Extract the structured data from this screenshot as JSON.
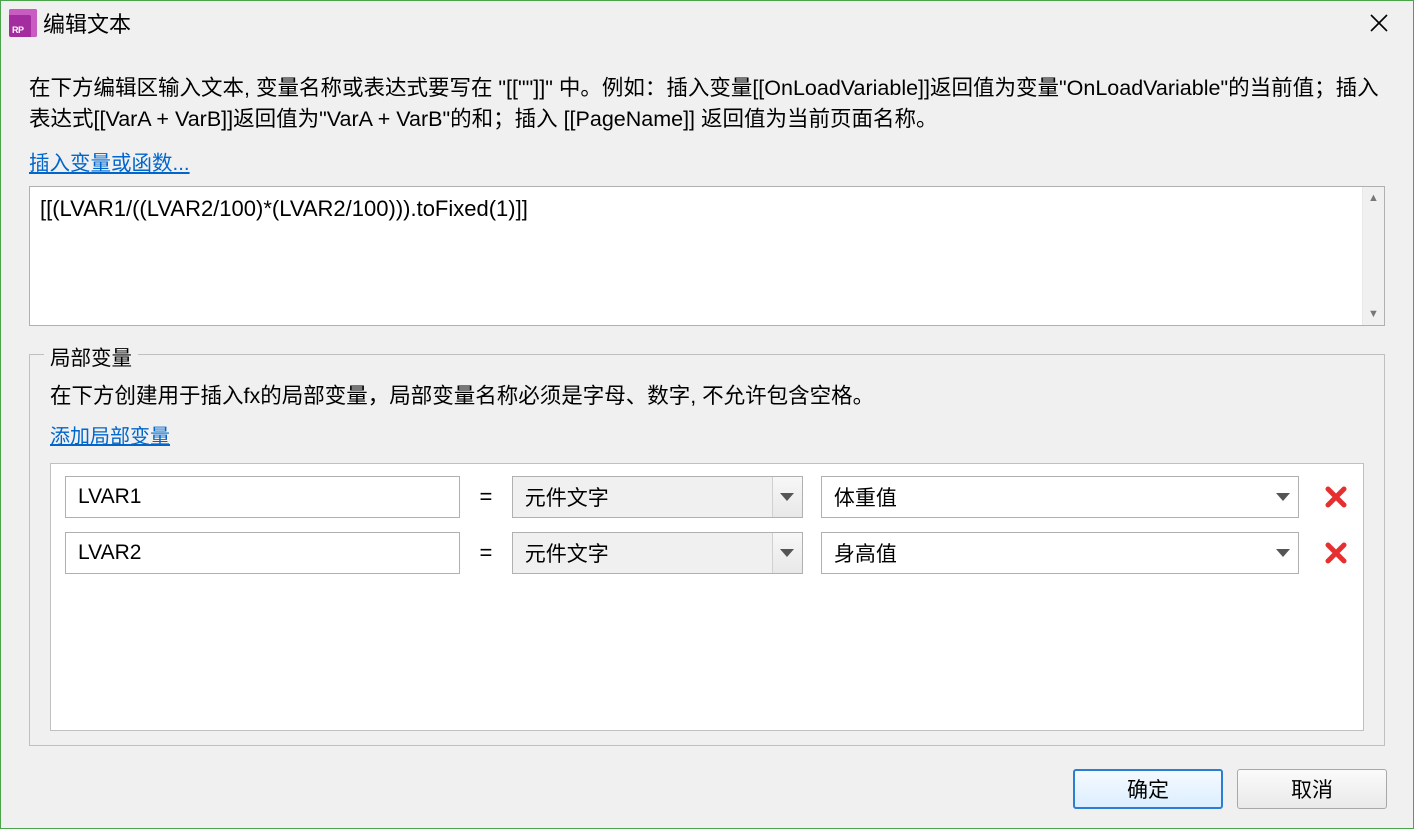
{
  "window": {
    "app_icon_text": "RP",
    "title": "编辑文本"
  },
  "help": "在下方编辑区输入文本, 变量名称或表达式要写在 \"[[\"\"]]\" 中。例如：插入变量[[OnLoadVariable]]返回值为变量\"OnLoadVariable\"的当前值；插入表达式[[VarA + VarB]]返回值为\"VarA + VarB\"的和；插入 [[PageName]] 返回值为当前页面名称。",
  "links": {
    "insert_var_or_func": "插入变量或函数...",
    "add_local_var": "添加局部变量"
  },
  "expression": "[[(LVAR1/((LVAR2/100)*(LVAR2/100))).toFixed(1)]]",
  "local_vars": {
    "legend": "局部变量",
    "help": "在下方创建用于插入fx的局部变量，局部变量名称必须是字母、数字, 不允许包含空格。",
    "rows": [
      {
        "name": "LVAR1",
        "type": "元件文字",
        "target": "体重值"
      },
      {
        "name": "LVAR2",
        "type": "元件文字",
        "target": "身高值"
      }
    ]
  },
  "buttons": {
    "ok": "确定",
    "cancel": "取消"
  }
}
